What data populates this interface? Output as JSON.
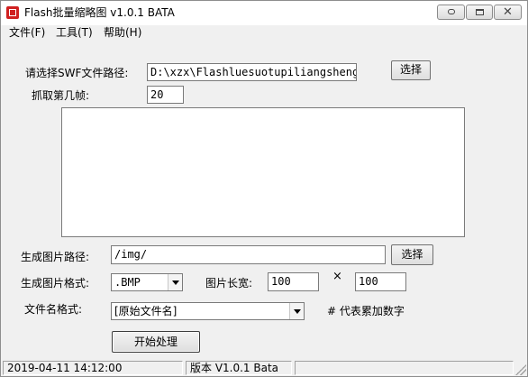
{
  "window": {
    "title": "Flash批量缩略图 v1.0.1 BATA",
    "close_glyph": "✕"
  },
  "menu": {
    "items": [
      "文件(F)",
      "工具(T)",
      "帮助(H)"
    ]
  },
  "form": {
    "swf_path_label": "请选择SWF文件路径:",
    "swf_path_value": "D:\\xzx\\Flashluesuotupiliangshengc",
    "swf_browse_label": "选择",
    "frame_label": "抓取第几帧:",
    "frame_value": "20",
    "output_path_label": "生成图片路径:",
    "output_path_value": "/img/",
    "output_browse_label": "选择",
    "format_label": "生成图片格式:",
    "format_value": ".BMP",
    "size_label": "图片长宽:",
    "width_value": "100",
    "times_sign": "×",
    "height_value": "100",
    "filename_label": "文件名格式:",
    "filename_value": "[原始文件名]",
    "filename_hint": "# 代表累加数字",
    "start_button_label": "开始处理"
  },
  "statusbar": {
    "datetime": "2019-04-11 14:12:00",
    "version": "版本 V1.0.1 Bata"
  }
}
